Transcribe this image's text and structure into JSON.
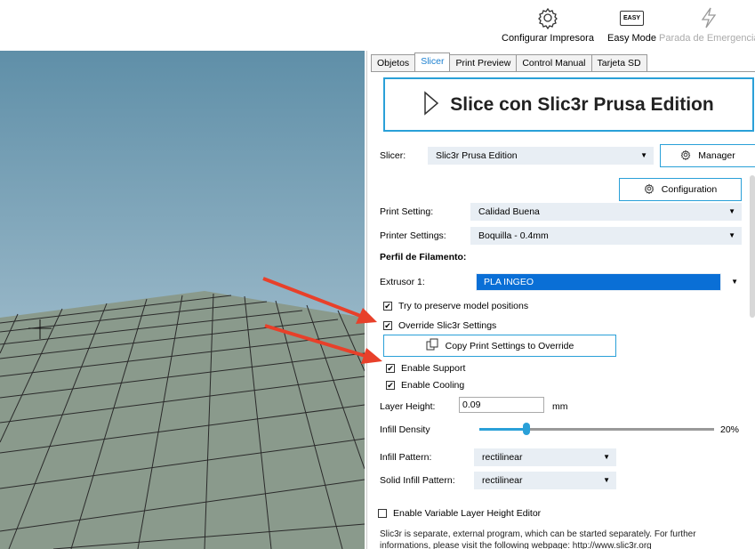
{
  "toolbar": {
    "configure_printer": "Configurar Impresora",
    "easy_mode": "Easy Mode",
    "easy_badge": "EASY",
    "emergency_stop": "Parada de Emergencia"
  },
  "tabs": [
    {
      "label": "Objetos",
      "active": false
    },
    {
      "label": "Slicer",
      "active": true
    },
    {
      "label": "Print Preview",
      "active": false
    },
    {
      "label": "Control Manual",
      "active": false
    },
    {
      "label": "Tarjeta SD",
      "active": false
    }
  ],
  "slice_button": "Slice con Slic3r Prusa Edition",
  "slicer": {
    "label": "Slicer:",
    "value": "Slic3r Prusa Edition",
    "manager_button": "Manager",
    "configuration_button": "Configuration"
  },
  "print_setting": {
    "label": "Print Setting:",
    "value": "Calidad Buena"
  },
  "printer_settings": {
    "label": "Printer Settings:",
    "value": "Boquilla - 0.4mm"
  },
  "filament": {
    "heading": "Perfil de Filamento:",
    "extruder_label": "Extrusor 1:",
    "extruder_value": "PLA INGEO"
  },
  "options": {
    "preserve_positions": {
      "label": "Try to preserve model positions",
      "checked": true
    },
    "override_settings": {
      "label": "Override Slic3r Settings",
      "checked": true
    },
    "copy_button": "Copy Print Settings to Override",
    "enable_support": {
      "label": "Enable Support",
      "checked": true
    },
    "enable_cooling": {
      "label": "Enable Cooling",
      "checked": true
    }
  },
  "layer_height": {
    "label": "Layer Height:",
    "value": "0.09",
    "unit": "mm"
  },
  "infill_density": {
    "label": "Infill Density",
    "value_text": "20%",
    "level": 0.2
  },
  "infill_pattern": {
    "label": "Infill Pattern:",
    "value": "rectilinear"
  },
  "solid_infill_pattern": {
    "label": "Solid Infill Pattern:",
    "value": "rectilinear"
  },
  "variable_layer": {
    "label": "Enable Variable Layer Height Editor",
    "checked": false
  },
  "info_text": "Slic3r is separate, external program, which can be started separately. For further informations, please visit the following webpage: http://www.slic3r.org",
  "colors": {
    "accent": "#2aa0d8",
    "selection": "#0a6fd6",
    "sky_top": "#5f8fa8",
    "sky_bottom": "#c4d6e0",
    "floor": "#8a9a8c",
    "arrow": "#e8402a"
  },
  "check_mark": "✔"
}
